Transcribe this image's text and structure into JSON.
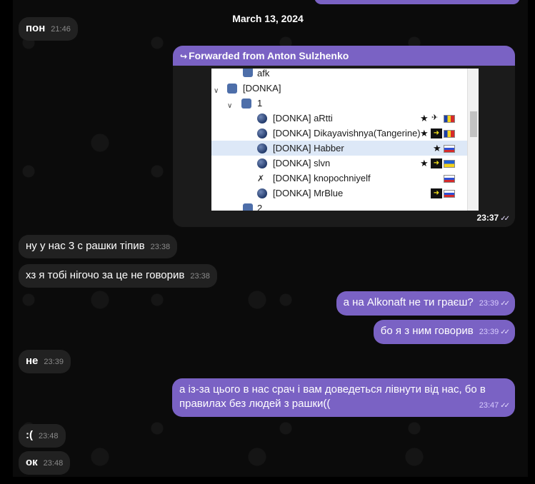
{
  "date_separator": "March 13, 2024",
  "messages": {
    "m1": {
      "text": "пон",
      "time": "21:46"
    },
    "forward": {
      "header": "Forwarded from Anton Sulzhenko",
      "time": "23:37",
      "screenshot": {
        "rows": [
          {
            "label": "afk",
            "icon": "channel-icon"
          },
          {
            "label": "[DONKA]",
            "icon": "channel-icon",
            "twisty": "∨"
          },
          {
            "label": "1",
            "icon": "channel-icon",
            "twisty": "∨"
          },
          {
            "label": "[DONKA] aRtti",
            "icon": "client-icon",
            "flags": [
              "star",
              "plane",
              "ro"
            ]
          },
          {
            "label": "[DONKA] Dikayavishnya(Tangerine)",
            "icon": "client-icon",
            "flags": [
              "star",
              "badge",
              "ro"
            ]
          },
          {
            "label": "[DONKA] Habber",
            "icon": "client-icon",
            "flags": [
              "star",
              "ru"
            ],
            "selected": true
          },
          {
            "label": "[DONKA] slvn",
            "icon": "client-icon",
            "flags": [
              "star",
              "badge",
              "ua"
            ]
          },
          {
            "label": "[DONKA] knopochniyelf",
            "icon": "muted-client-icon",
            "flags": [
              "ru"
            ]
          },
          {
            "label": "[DONKA] MrBlue",
            "icon": "client-icon",
            "flags": [
              "badge",
              "ru"
            ]
          },
          {
            "label": "2",
            "icon": "channel-icon"
          }
        ]
      }
    },
    "m2": {
      "text": "ну у нас 3 с рашки тіпив",
      "time": "23:38"
    },
    "m3": {
      "text": "хз я тобі нігочо за це не говорив",
      "time": "23:38"
    },
    "m4": {
      "text": "а на Alkonaft не ти граєш?",
      "time": "23:39"
    },
    "m5": {
      "text": "бо я з ним говорив",
      "time": "23:39"
    },
    "m6": {
      "text": "не",
      "time": "23:39"
    },
    "m7": {
      "line1": "а із-за цього в нас срач і вам доведеться лівнути від нас, бо в",
      "line2": "правилах без людей з рашки((",
      "time": "23:47"
    },
    "m8": {
      "text": ":(",
      "time": "23:48"
    },
    "m9": {
      "text": "ок",
      "time": "23:48"
    }
  },
  "colors": {
    "outgoing_bubble": "#7a62c4",
    "incoming_bubble": "#212121",
    "background": "#0b0b0b"
  }
}
